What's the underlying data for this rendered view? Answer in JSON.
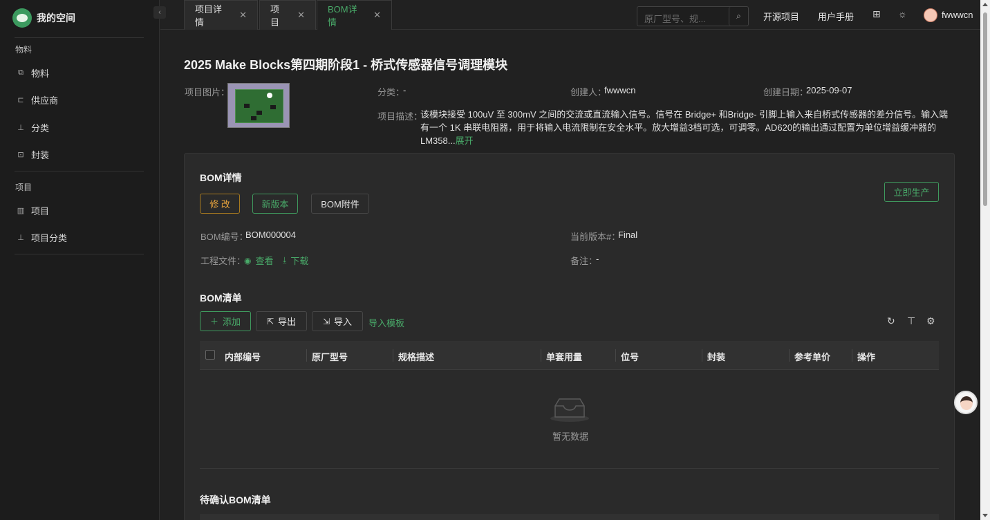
{
  "sidebar": {
    "brand": "我的空间",
    "collapse_icon": "chevron-left-icon",
    "groups": [
      {
        "title": "物料",
        "items": [
          {
            "label": "物料",
            "icon": "copy-icon"
          },
          {
            "label": "供应商",
            "icon": "link-icon"
          },
          {
            "label": "分类",
            "icon": "hierarchy-icon"
          },
          {
            "label": "封装",
            "icon": "chip-icon"
          }
        ]
      },
      {
        "title": "项目",
        "items": [
          {
            "label": "项目",
            "icon": "project-icon"
          },
          {
            "label": "项目分类",
            "icon": "hierarchy-icon"
          }
        ]
      }
    ]
  },
  "tabs": [
    {
      "label": "项目详情",
      "active": false
    },
    {
      "label": "项目",
      "active": false
    },
    {
      "label": "BOM详情",
      "active": true
    }
  ],
  "header": {
    "search_placeholder": "原厂型号、规...",
    "links": [
      "开源项目",
      "用户手册"
    ],
    "username": "fwwwcn"
  },
  "project": {
    "title": "2025 Make Blocks第四期阶段1 - 桥式传感器信号调理模块",
    "image_label": "项目图片：",
    "category_label": "分类：",
    "category_value": "-",
    "creator_label": "创建人：",
    "creator_value": "fwwwcn",
    "created_label": "创建日期：",
    "created_value": "2025-09-07",
    "desc_label": "项目描述：",
    "desc_value": "该模块接受 100uV 至 300mV 之间的交流或直流输入信号。信号在 Bridge+ 和Bridge- 引脚上输入来自桥式传感器的差分信号。输入端有一个 1K 串联电阻器，用于将输入电流限制在安全水平。放大增益3档可选，可调零。AD620的输出通过配置为单位增益缓冲器的LM358...",
    "expand_label": "展开"
  },
  "bom": {
    "section_title": "BOM详情",
    "btn_edit": "修 改",
    "btn_new_version": "新版本",
    "btn_attachment": "BOM附件",
    "btn_produce": "立即生产",
    "number_label": "BOM编号：",
    "number_value": "BOM000004",
    "version_label": "当前版本#：",
    "version_value": "Final",
    "files_label": "工程文件：",
    "view_label": "查看",
    "download_label": "下载",
    "remark_label": "备注：",
    "remark_value": "-"
  },
  "bom_list": {
    "section_title": "BOM清单",
    "btn_add": "添加",
    "btn_export": "导出",
    "btn_import": "导入",
    "import_template": "导入模板",
    "columns": [
      "内部编号",
      "原厂型号",
      "规格描述",
      "单套用量",
      "位号",
      "封装",
      "参考单价",
      "操作"
    ],
    "empty_text": "暂无数据"
  },
  "pending": {
    "section_title": "待确认BOM清单"
  },
  "colors": {
    "accent": "#49aa69",
    "warning": "#e6a23c",
    "background": "#212121"
  }
}
